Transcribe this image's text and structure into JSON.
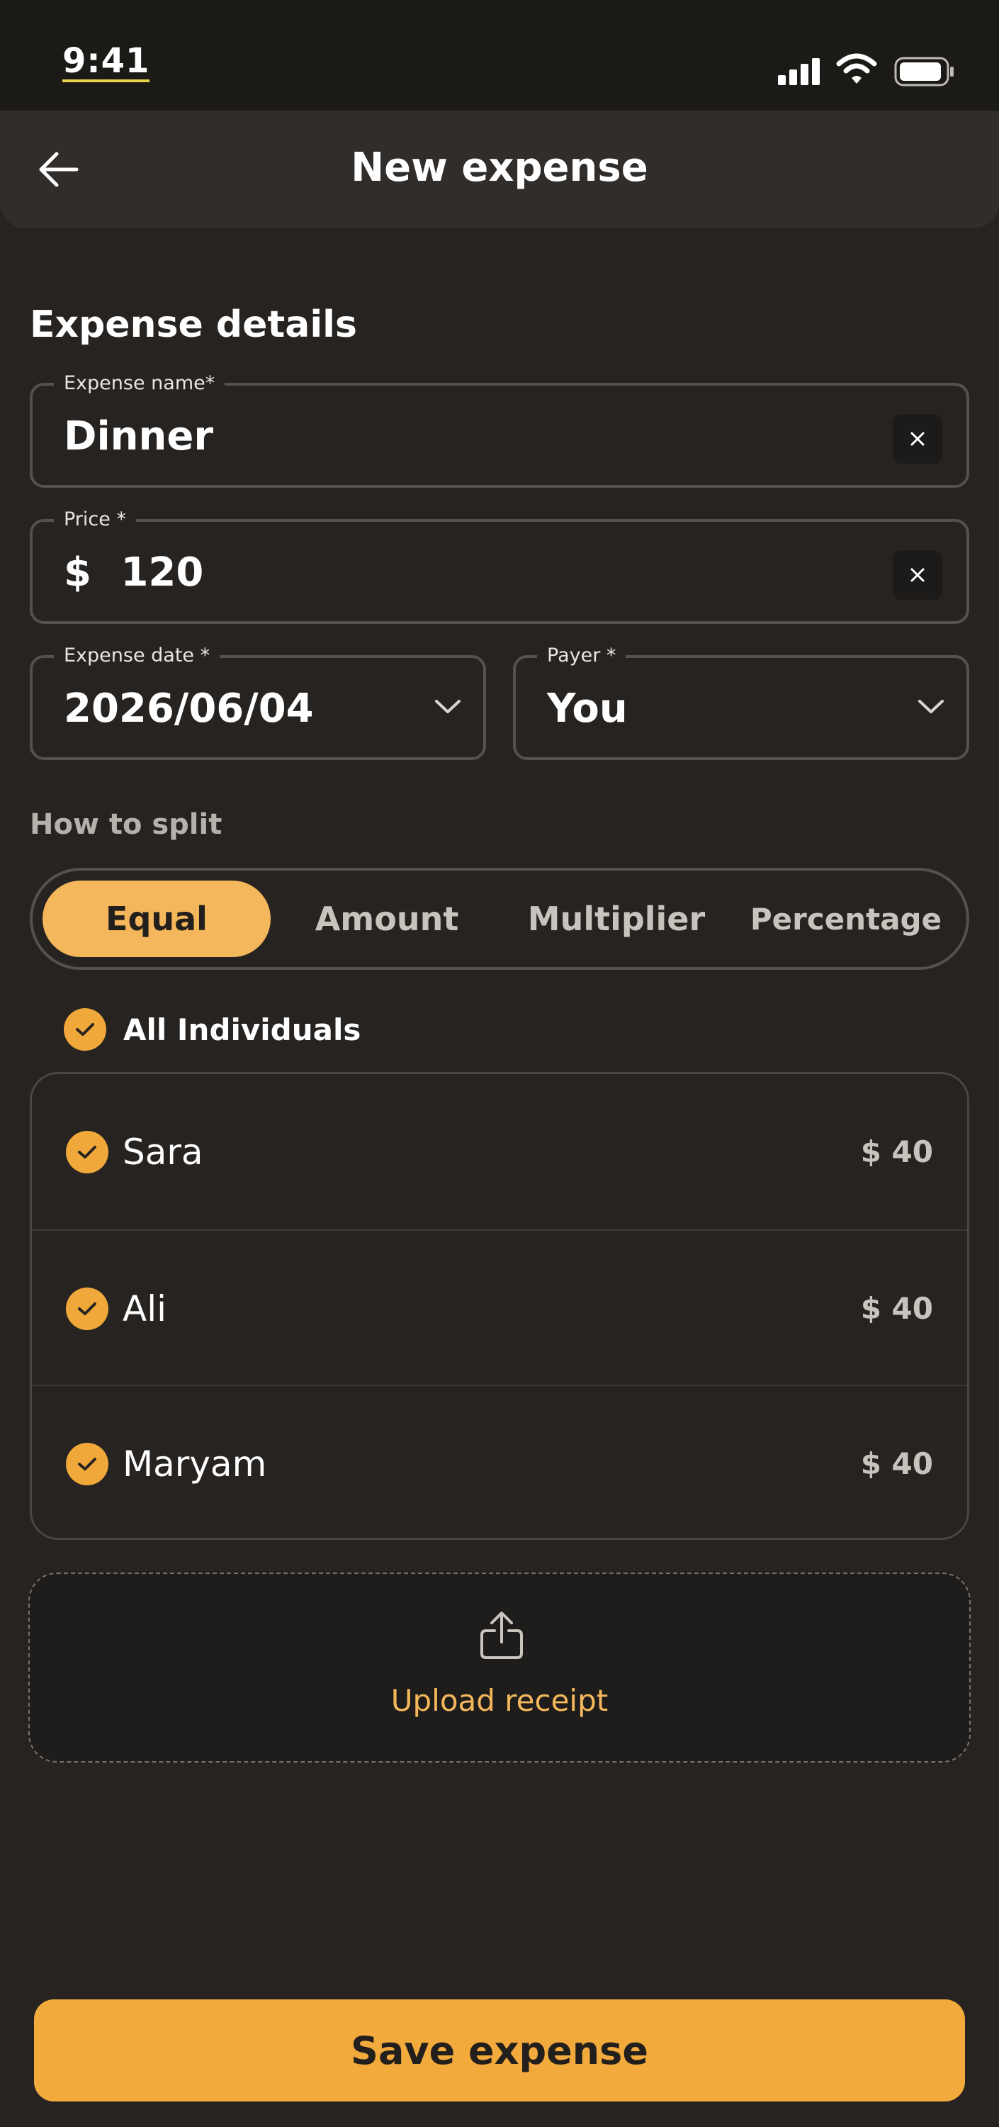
{
  "status_bar": {
    "time": "9:41"
  },
  "header": {
    "title": "New expense"
  },
  "details": {
    "title": "Expense details",
    "name": {
      "label": "Expense name*",
      "value": "Dinner"
    },
    "price": {
      "label": "Price *",
      "currency": "$",
      "value": "120"
    },
    "date": {
      "label": "Expense date *",
      "value": "2026/06/04"
    },
    "payer": {
      "label": "Payer *",
      "value": "You"
    }
  },
  "split": {
    "title": "How to split",
    "tabs": [
      {
        "label": "Equal",
        "active": true
      },
      {
        "label": "Amount",
        "active": false
      },
      {
        "label": "Multiplier",
        "active": false
      },
      {
        "label": "Percentage",
        "active": false
      }
    ],
    "all_label": "All Individuals",
    "people": [
      {
        "name": "Sara",
        "amount": "$ 40",
        "checked": true
      },
      {
        "name": "Ali",
        "amount": "$ 40",
        "checked": true
      },
      {
        "name": "Maryam",
        "amount": "$ 40",
        "checked": true
      }
    ]
  },
  "upload": {
    "label": "Upload receipt"
  },
  "save": {
    "label": "Save expense"
  },
  "colors": {
    "accent": "#f2aa3c",
    "background": "#262321",
    "header": "#302d2a"
  }
}
